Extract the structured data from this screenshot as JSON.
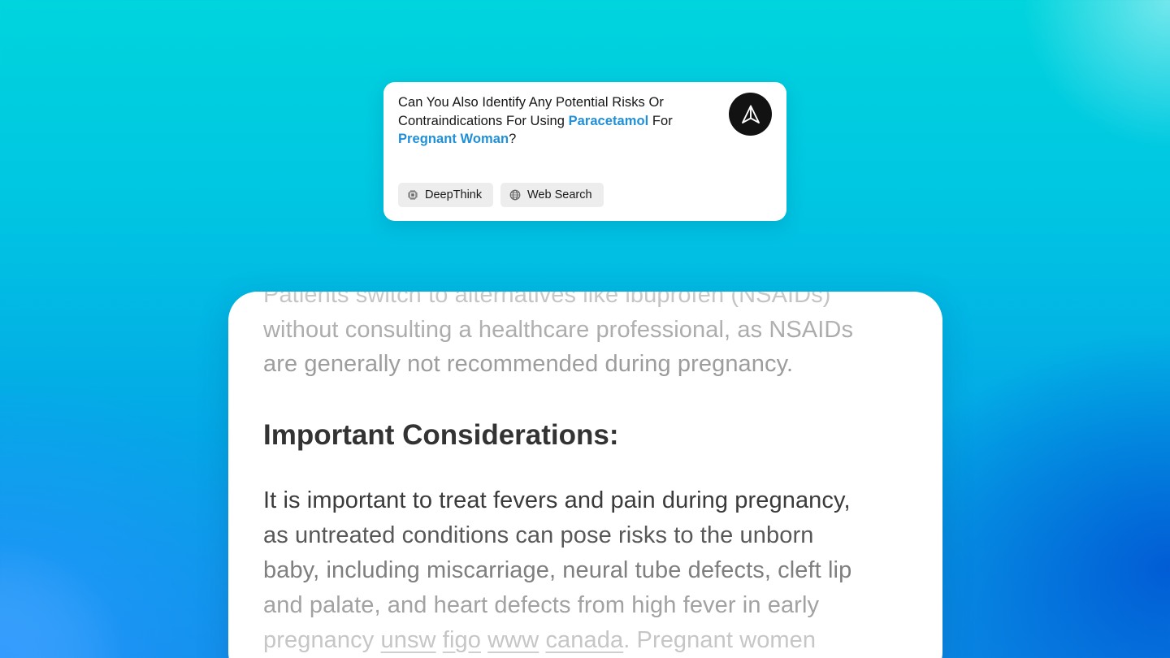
{
  "prompt": {
    "text_before_1": "Can You Also Identify Any Potential Risks Or Contraindications For Using ",
    "highlight_1": "Paracetamol",
    "text_between": " For ",
    "highlight_2": "Pregnant Woman",
    "text_after": "?",
    "send_icon": "send-arrow-icon"
  },
  "chips": [
    {
      "label": "DeepThink",
      "icon": "chip-icon"
    },
    {
      "label": "Web Search",
      "icon": "globe-icon"
    }
  ],
  "answer": {
    "prev_para": [
      "Patients switch to alternatives like ibuprofen (NSAIDs)",
      "without consulting a healthcare professional, as NSAIDs",
      "are generally not recommended during pregnancy."
    ],
    "heading": "Important Considerations:",
    "para": [
      "It is important to treat fevers and pain during pregnancy,",
      "as untreated conditions can pose risks to the unborn",
      "baby, including miscarriage, neural tube defects, cleft lip",
      "and palate, and heart defects from high fever in early"
    ],
    "last_line_start": "pregnancy ",
    "citations": [
      "unsw",
      "figo",
      "www",
      "canada"
    ],
    "last_line_end": ". Pregnant women"
  },
  "colors": {
    "highlight": "#1f8fd8",
    "send_button": "#121212"
  }
}
